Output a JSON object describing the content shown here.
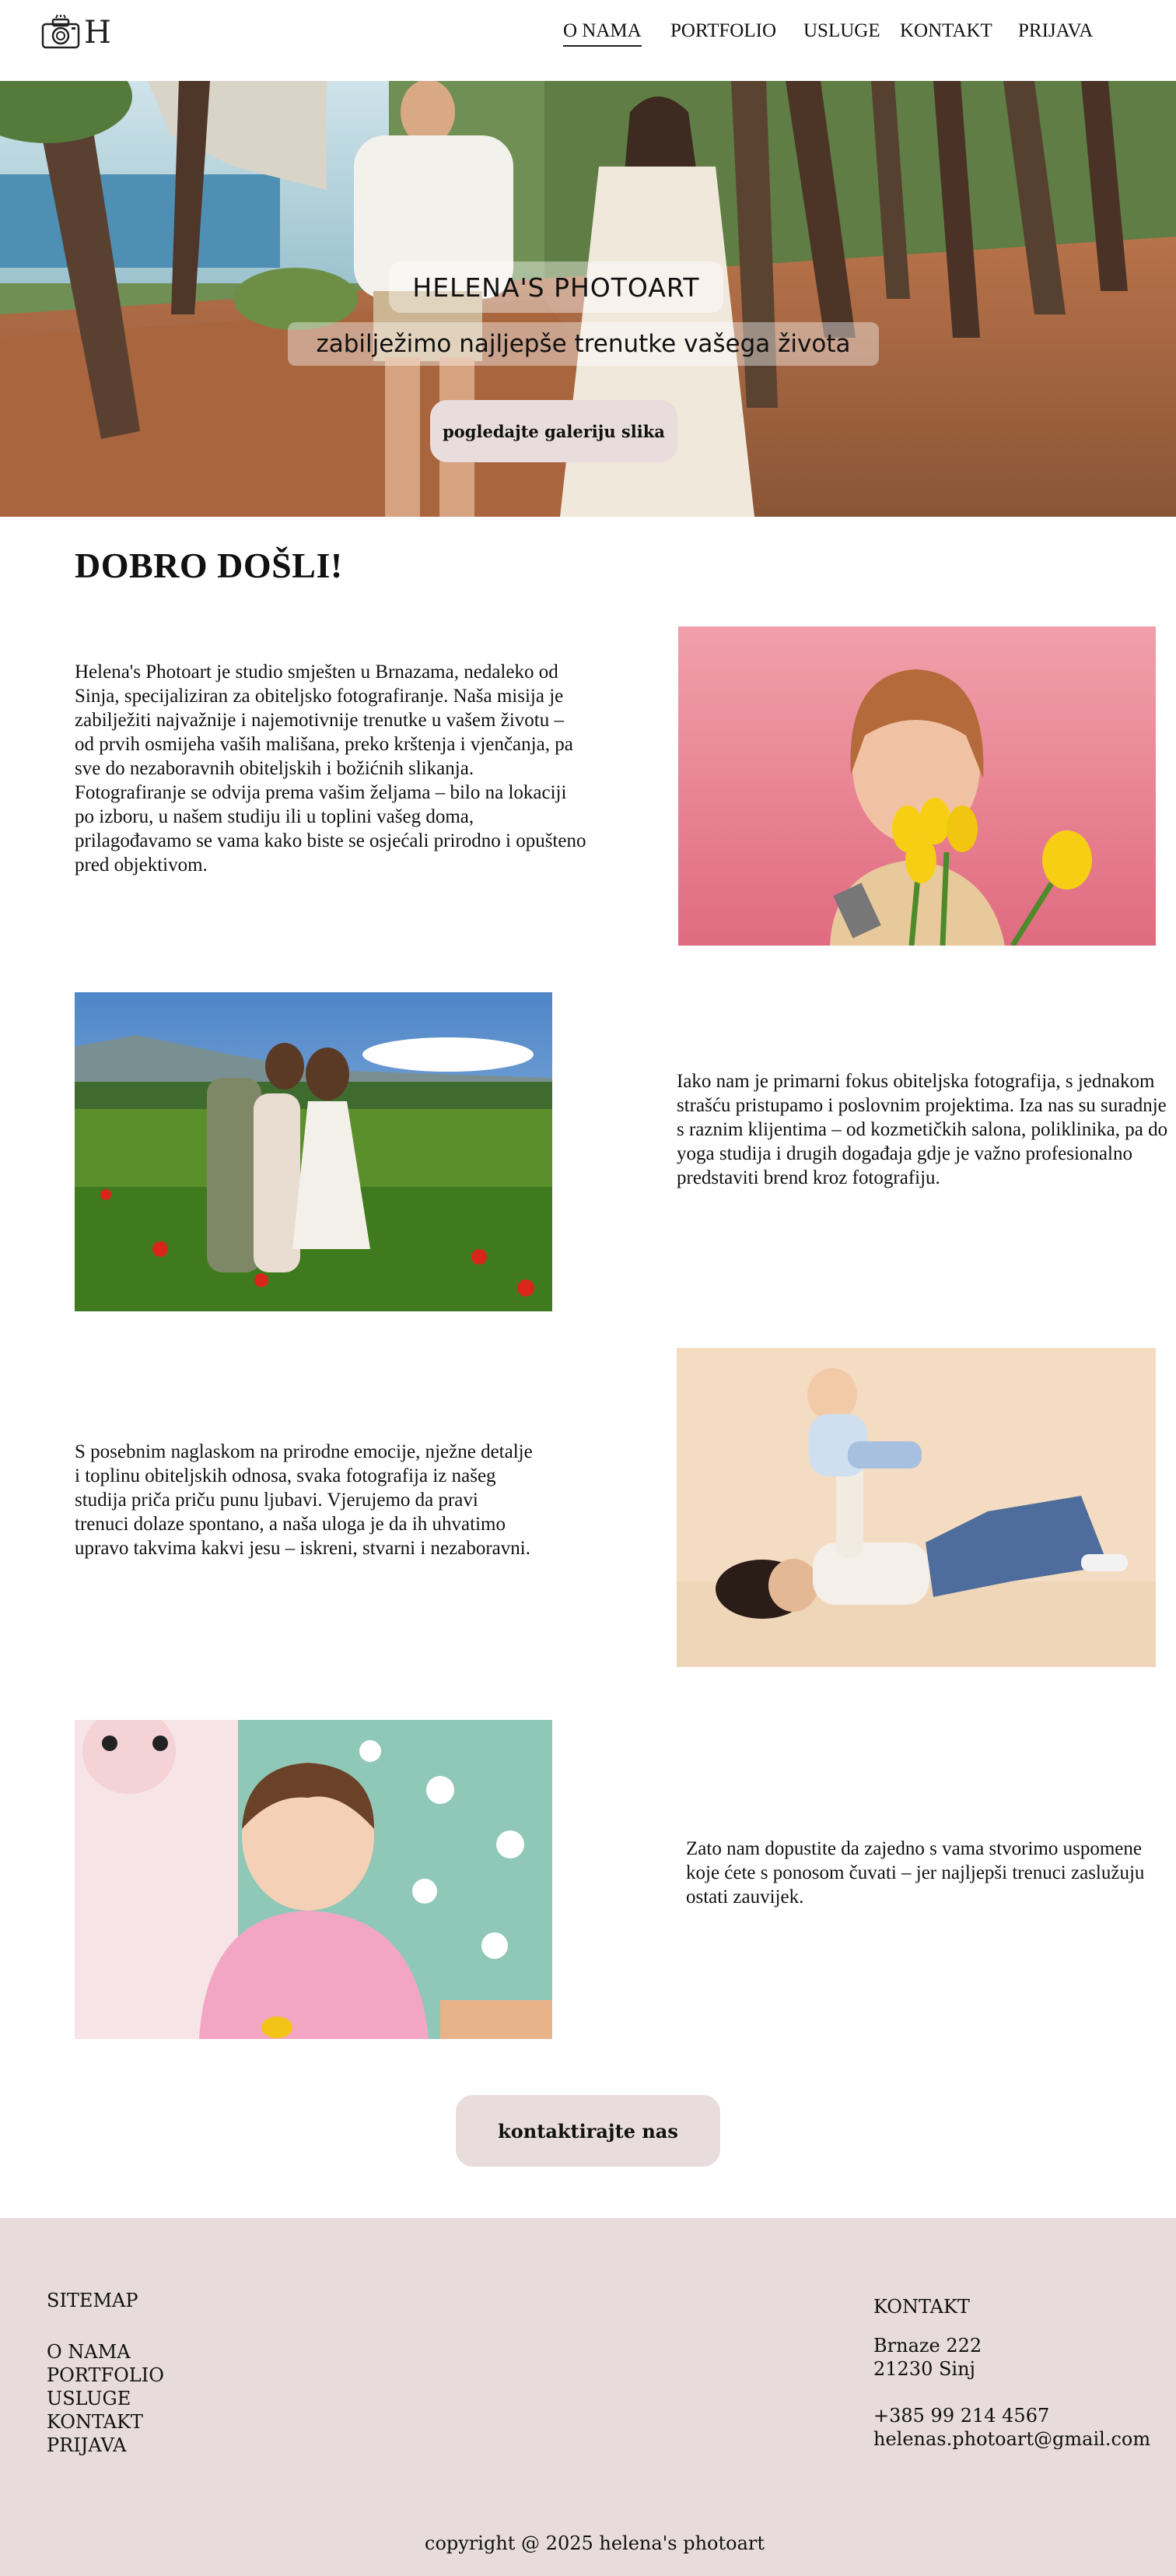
{
  "header": {
    "logo_letter": "H",
    "nav": [
      "O NAMA",
      "PORTFOLIO",
      "USLUGE",
      "KONTAKT",
      "PRIJAVA"
    ],
    "active_nav": "O NAMA"
  },
  "hero": {
    "title": "HELENA'S PHOTOART",
    "subtitle": "zabilježimo najljepše trenutke vašega života",
    "button": "pogledajte galeriju slika"
  },
  "content": {
    "heading": "DOBRO DOŠLI!",
    "paragraphs": [
      "Helena's Photoart  je studio smješten u Brnazama, nedaleko od Sinja, specijaliziran za obiteljsko fotografiranje. Naša misija je zabilježiti najvažnije i najemotivnije trenutke u vašem životu – od prvih osmijeha vaših mališana, preko krštenja i vjenčanja, pa sve do nezaboravnih obiteljskih i božićnih slikanja. Fotografiranje se odvija prema vašim željama – bilo na lokaciji po izboru, u našem studiju ili u toplini vašeg doma, prilagođavamo se vama kako biste se osjećali prirodno i opušteno pred objektivom.",
      "Iako nam je primarni fokus obiteljska fotografija, s jednakom strašću pristupamo i poslovnim projektima. Iza nas su suradnje s raznim klijentima – od kozmetičkih salona, poliklinika, pa do yoga studija i drugih događaja gdje je važno profesionalno predstaviti brend kroz fotografiju.",
      "S posebnim naglaskom na prirodne emocije, nježne detalje i toplinu obiteljskih odnosa, svaka fotografija iz našeg studija priča priču punu ljubavi. Vjerujemo da pravi trenuci dolaze spontano, a naša uloga je da ih uhvatimo upravo takvima kakvi jesu – iskreni, stvarni i nezaboravni.",
      "Zato nam dopustite da zajedno s vama stvorimo uspomene koje ćete s ponosom čuvati – jer najljepši trenuci zaslužuju ostati zauvijek."
    ],
    "contact_button": "kontaktirajte nas"
  },
  "footer": {
    "sitemap_title": "SITEMAP",
    "sitemap_links": [
      "O NAMA",
      "PORTFOLIO",
      "USLUGE",
      "KONTAKT",
      "PRIJAVA"
    ],
    "contact_title": "KONTAKT",
    "address_line1": "Brnaze 222",
    "address_line2": "21230 Sinj",
    "phone": "+385 99 214 4567",
    "email": "helenas.photoart@gmail.com",
    "copyright": "copyright @ 2025 helena's photoart"
  },
  "colors": {
    "accent": "#e9dcdc",
    "footer_bg": "#e8dbdb",
    "text": "#111111"
  }
}
